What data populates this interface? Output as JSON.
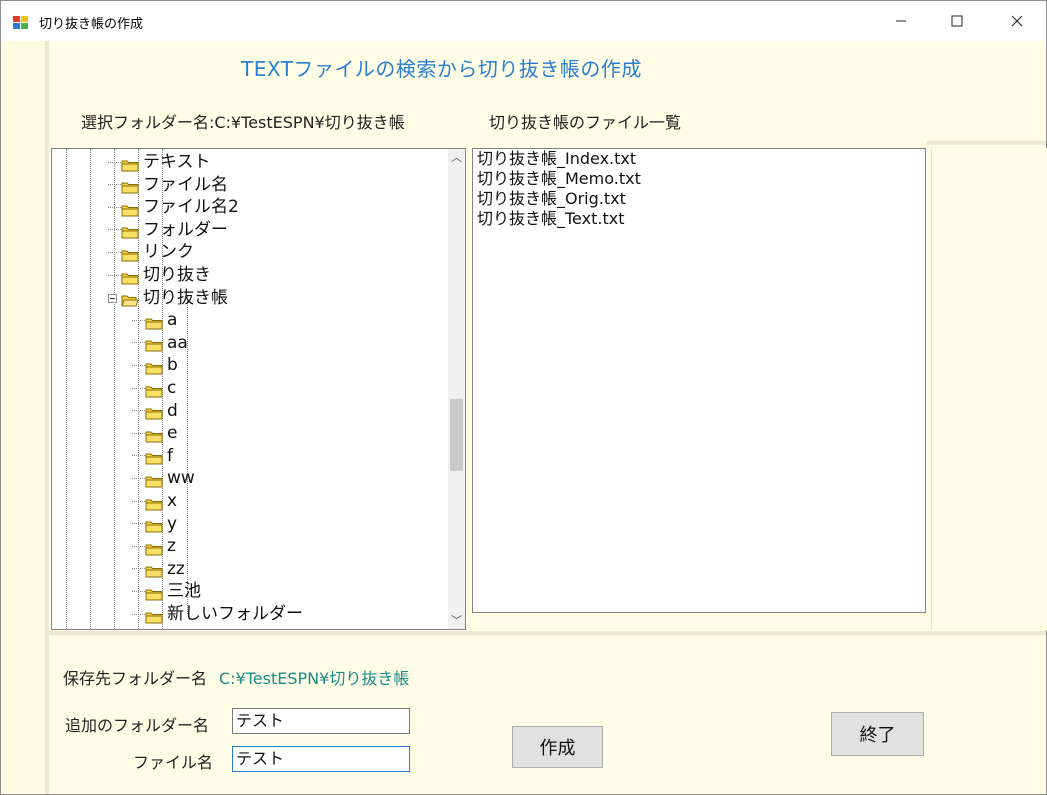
{
  "window": {
    "title": "切り抜き帳の作成",
    "controls": {
      "minimize": "—",
      "maximize": "☐",
      "close": "✕"
    }
  },
  "heading": "TEXTファイルの検索から切り抜き帳の作成",
  "selected_folder": {
    "label": "選択フォルダー名:",
    "value": "C:¥TestESPN¥切り抜き帳"
  },
  "file_list_label": "切り抜き帳のファイル一覧",
  "tree": {
    "items": [
      {
        "label": "テキスト",
        "level": 0
      },
      {
        "label": "ファイル名",
        "level": 0
      },
      {
        "label": "ファイル名2",
        "level": 0
      },
      {
        "label": "フォルダー",
        "level": 0
      },
      {
        "label": "リンク",
        "level": 0
      },
      {
        "label": "切り抜き",
        "level": 0
      },
      {
        "label": "切り抜き帳",
        "level": 0,
        "expanded": true
      },
      {
        "label": "a",
        "level": 1
      },
      {
        "label": "aa",
        "level": 1
      },
      {
        "label": "b",
        "level": 1
      },
      {
        "label": "c",
        "level": 1
      },
      {
        "label": "d",
        "level": 1
      },
      {
        "label": "e",
        "level": 1
      },
      {
        "label": "f",
        "level": 1
      },
      {
        "label": "ww",
        "level": 1
      },
      {
        "label": "x",
        "level": 1
      },
      {
        "label": "y",
        "level": 1
      },
      {
        "label": "z",
        "level": 1
      },
      {
        "label": "zz",
        "level": 1
      },
      {
        "label": "三池",
        "level": 1
      },
      {
        "label": "新しいフォルダー",
        "level": 1
      }
    ]
  },
  "files": [
    "切り抜き帳_Index.txt",
    "切り抜き帳_Memo.txt",
    "切り抜き帳_Orig.txt",
    "切り抜き帳_Text.txt"
  ],
  "save_folder": {
    "label": "保存先フォルダー名",
    "value": "C:¥TestESPN¥切り抜き帳"
  },
  "add_folder": {
    "label": "追加のフォルダー名",
    "value": "テスト"
  },
  "file_name": {
    "label": "ファイル名",
    "value": "テスト"
  },
  "buttons": {
    "create": "作成",
    "exit": "終了"
  },
  "colors": {
    "background": "#fffde6",
    "heading": "#2b7fd0",
    "path_value": "#1a8a8a",
    "folder": "#f5d33b"
  }
}
